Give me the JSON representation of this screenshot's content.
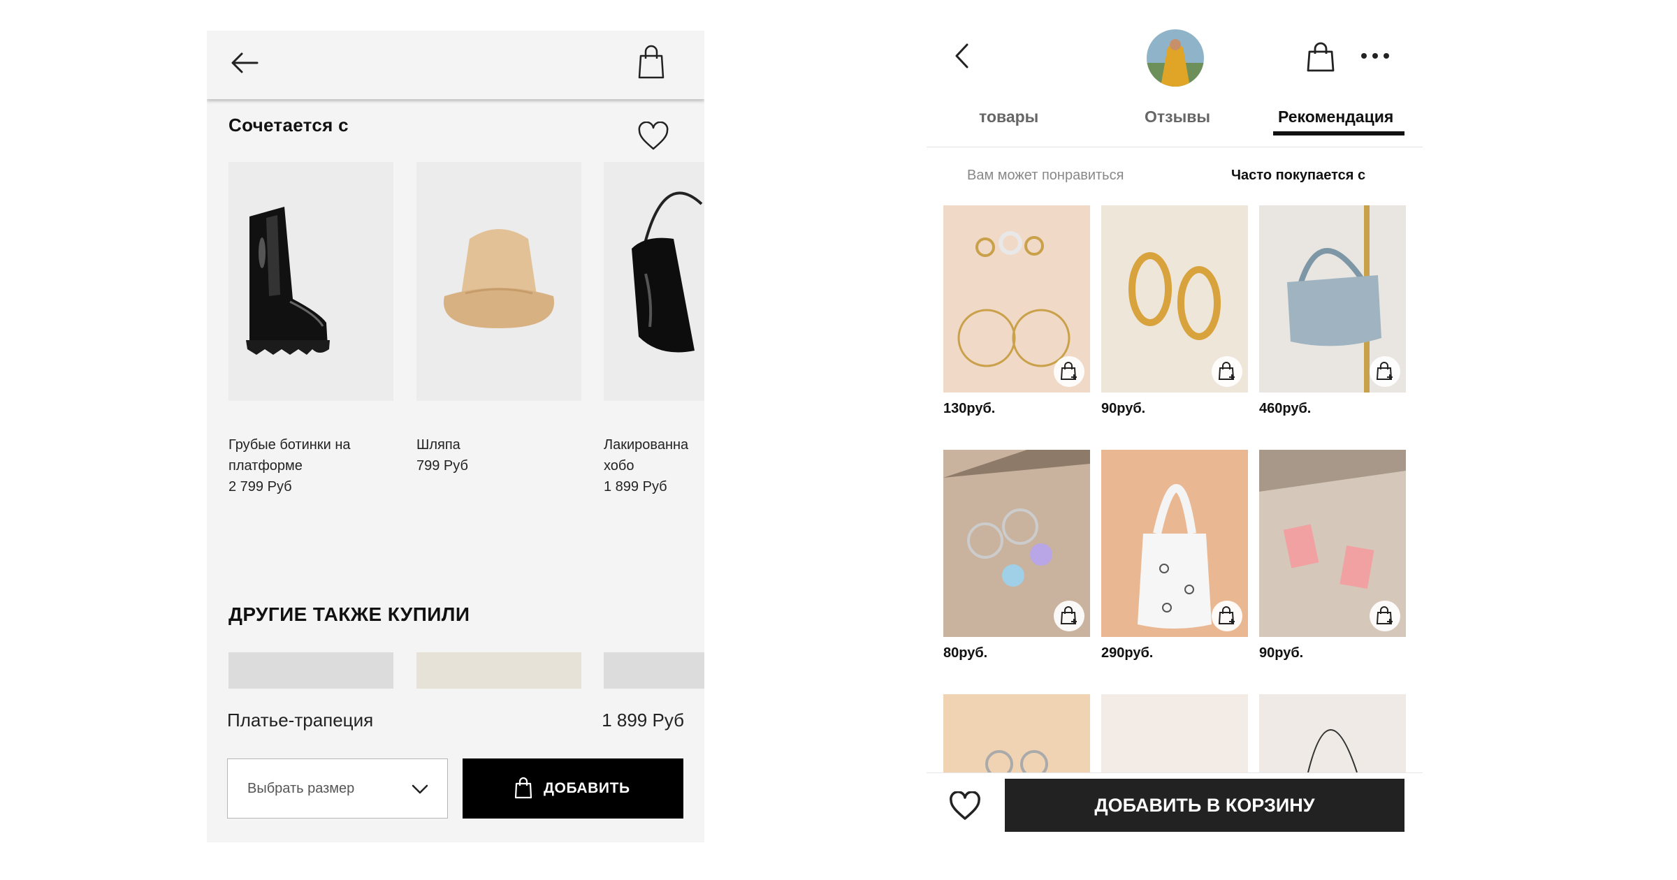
{
  "left": {
    "section_title": "Сочетается с",
    "products": [
      {
        "name_line1": "Грубые ботинки на",
        "name_line2": "платформе",
        "price": "2 799 Руб"
      },
      {
        "name_line1": "Шляпа",
        "name_line2": "",
        "price": "799 Руб"
      },
      {
        "name_line1": "Лакированна",
        "name_line2": "хобо",
        "price": "1 899 Руб"
      }
    ],
    "section2_title": "ДРУГИЕ ТАКЖЕ КУПИЛИ",
    "product_name": "Платье-трапеция",
    "product_price": "1 899 Руб",
    "size_placeholder": "Выбрать размер",
    "add_label": "ДОБАВИТЬ"
  },
  "right": {
    "tabs": [
      {
        "label": "товары"
      },
      {
        "label": "Отзывы"
      },
      {
        "label": "Рекомендация"
      }
    ],
    "subtabs": [
      {
        "label": "Вам может понравиться"
      },
      {
        "label": "Часто покупается с"
      }
    ],
    "items": [
      {
        "price": "130руб."
      },
      {
        "price": "90руб."
      },
      {
        "price": "460руб."
      },
      {
        "price": "80руб."
      },
      {
        "price": "290руб."
      },
      {
        "price": "90руб."
      }
    ],
    "add_to_cart_label": "ДОБАВИТЬ В КОРЗИНУ"
  },
  "icons": [
    "arrow-left-icon",
    "shopping-bag-icon",
    "heart-icon",
    "chevron-down-icon",
    "more-dots-icon",
    "add-to-cart-icon",
    "chevron-left-icon"
  ],
  "colors": {
    "left_bg": "#f4f4f4",
    "add_button": "#000000",
    "cart_button": "#222222"
  }
}
